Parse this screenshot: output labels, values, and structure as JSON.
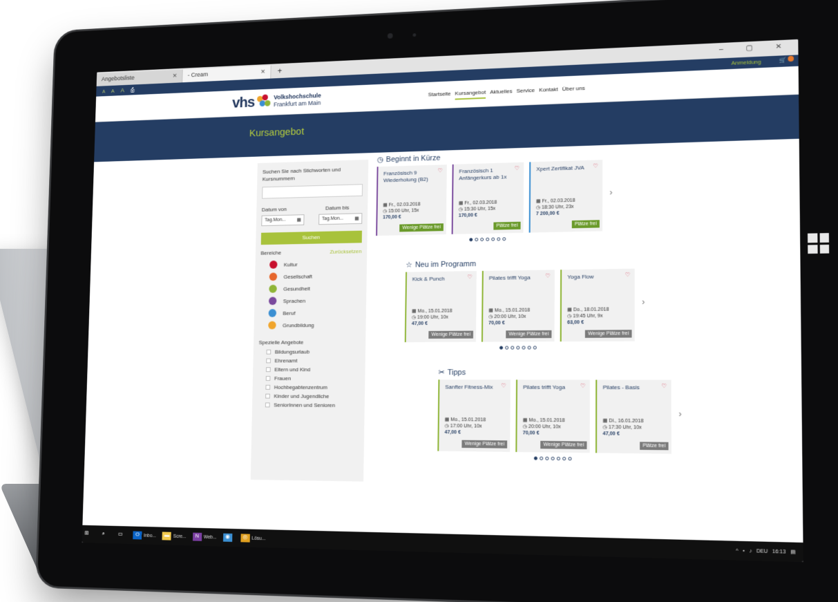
{
  "browser": {
    "tabs": [
      {
        "label": "Angebotsliste",
        "close": "✕"
      },
      {
        "label": "- Cream",
        "close": "✕"
      }
    ],
    "new_tab": "+",
    "window_controls": "– ▢ ✕"
  },
  "topstrip": {
    "font_sizes": [
      "A",
      "A",
      "A"
    ],
    "login": "Anmeldung"
  },
  "header": {
    "brand": "vhs",
    "brand_line1": "Volkshochschule",
    "brand_line2": "Frankfurt am Main",
    "nav": [
      "Startseite",
      "Kursangebot",
      "Aktuelles",
      "Service",
      "Kontakt",
      "Über uns"
    ]
  },
  "hero": {
    "title": "Kursangebot"
  },
  "sidebar": {
    "search_label": "Suchen Sie nach Stichworten und Kursnummern",
    "date_from": "Datum von",
    "date_to": "Datum bis",
    "date_placeholder": "Tag.Mon...",
    "search_button": "Suchen",
    "bereiche": "Bereiche",
    "reset": "Zurücksetzen",
    "areas": [
      {
        "label": "Kultur",
        "color": "#c8102e",
        "icon": "kultur-icon"
      },
      {
        "label": "Gesellschaft",
        "color": "#e6662c",
        "icon": "gesellschaft-icon"
      },
      {
        "label": "Gesundheit",
        "color": "#8fb537",
        "icon": "gesundheit-icon"
      },
      {
        "label": "Sprachen",
        "color": "#7a4a9d",
        "icon": "sprachen-icon"
      },
      {
        "label": "Beruf",
        "color": "#3b8fd2",
        "icon": "beruf-icon"
      },
      {
        "label": "Grundbildung",
        "color": "#f0a52c",
        "icon": "grundbildung-icon"
      }
    ],
    "special_title": "Spezielle Angebote",
    "special": [
      "Bildungsurlaub",
      "Ehrenamt",
      "Eltern und Kind",
      "Frauen",
      "Hochbegabtenzentrum",
      "Kinder und Jugendliche",
      "SeniorInnen und Senioren"
    ]
  },
  "sections": [
    {
      "title": "Beginnt in Kürze",
      "icon": "clock-icon",
      "cards": [
        {
          "title": "Französisch 9 Wiederholung (B2)",
          "date": "Fr., 02.03.2018",
          "time": "15:00 Uhr, 15x",
          "price": "170,00 €",
          "badge": "Wenige Plätze frei",
          "accent": "#7a4a9d",
          "badge_color": "#6a9a2a"
        },
        {
          "title": "Französisch 1 Anfängerkurs ab 1x",
          "date": "Fr., 02.03.2018",
          "time": "15:30 Uhr, 15x",
          "price": "170,00 €",
          "badge": "Plätze frei",
          "accent": "#7a4a9d",
          "badge_color": "#6a9a2a"
        },
        {
          "title": "Xpert Zertifikat JVA",
          "date": "Fr., 02.03.2018",
          "time": "18:30 Uhr, 23x",
          "price": "7 200,00 €",
          "badge": "Plätze frei",
          "accent": "#3b8fd2",
          "badge_color": "#6a9a2a"
        }
      ]
    },
    {
      "title": "Neu im Programm",
      "icon": "star-icon",
      "cards": [
        {
          "title": "Kick & Punch",
          "date": "Mo., 15.01.2018",
          "time": "19:00 Uhr, 10x",
          "price": "47,00 €",
          "badge": "Wenige Plätze frei",
          "accent": "#8fb537",
          "badge_color": "#7b7b7b"
        },
        {
          "title": "Pilates trifft Yoga",
          "date": "Mo., 15.01.2018",
          "time": "20:00 Uhr, 10x",
          "price": "70,00 €",
          "badge": "Wenige Plätze frei",
          "accent": "#8fb537",
          "badge_color": "#7b7b7b"
        },
        {
          "title": "Yoga Flow",
          "date": "Do., 18.01.2018",
          "time": "19:45 Uhr, 9x",
          "price": "63,00 €",
          "badge": "Wenige Plätze frei",
          "accent": "#8fb537",
          "badge_color": "#7b7b7b"
        }
      ]
    },
    {
      "title": "Tipps",
      "icon": "scissors-icon",
      "cards": [
        {
          "title": "Sanfter Fitness-Mix",
          "date": "Mo., 15.01.2018",
          "time": "17:00 Uhr, 10x",
          "price": "47,00 €",
          "badge": "Wenige Plätze frei",
          "accent": "#8fb537",
          "badge_color": "#7b7b7b"
        },
        {
          "title": "Pilates trifft Yoga",
          "date": "Mo., 15.01.2018",
          "time": "20:00 Uhr, 10x",
          "price": "70,00 €",
          "badge": "Wenige Plätze frei",
          "accent": "#8fb537",
          "badge_color": "#7b7b7b"
        },
        {
          "title": "Pilates - Basis",
          "date": "Di., 16.01.2018",
          "time": "17:30 Uhr, 10x",
          "price": "47,00 €",
          "badge": "Plätze frei",
          "accent": "#8fb537",
          "badge_color": "#7b7b7b"
        }
      ]
    }
  ],
  "taskbar": {
    "apps": [
      {
        "label": "Inbo...",
        "icon": "outlook-icon"
      },
      {
        "label": "Scre...",
        "icon": "folder-icon"
      },
      {
        "label": "Web...",
        "icon": "onenote-icon"
      },
      {
        "label": "",
        "icon": "paint-icon"
      },
      {
        "label": "Lösu...",
        "icon": "chrome-icon"
      }
    ],
    "lang": "DEU",
    "clock": "16:13"
  }
}
